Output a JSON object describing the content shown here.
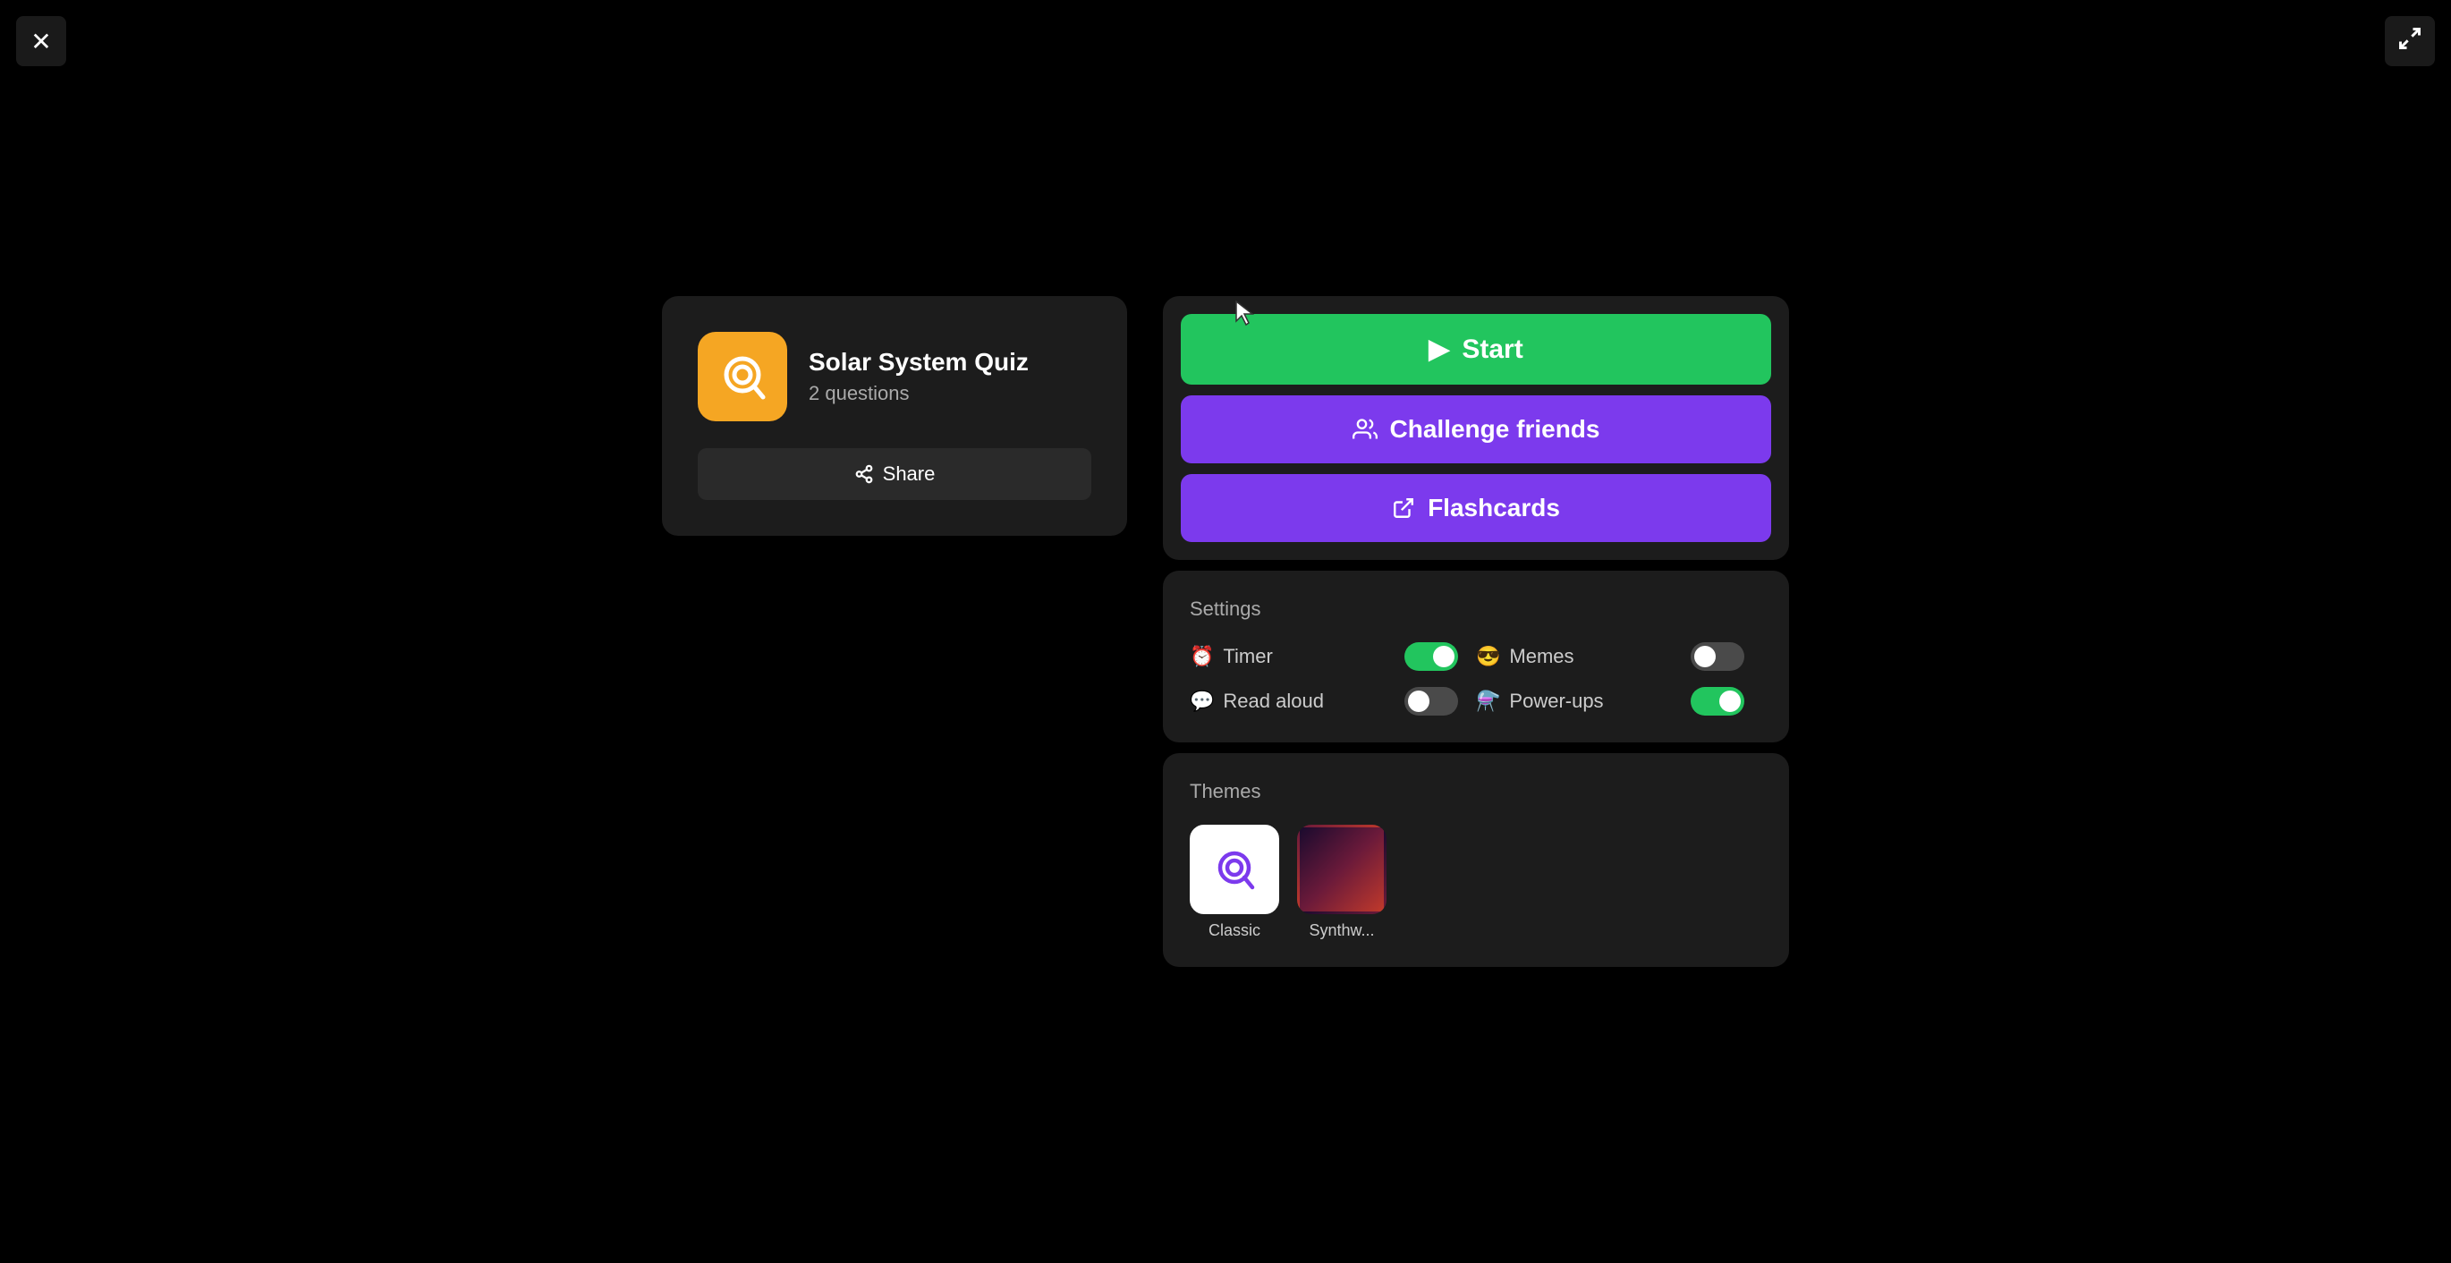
{
  "app": {
    "close_label": "✕",
    "fullscreen_label": "⛶"
  },
  "left_card": {
    "quiz_title": "Solar System Quiz",
    "quiz_subtitle": "2 questions",
    "share_label": "Share"
  },
  "action_buttons": {
    "start_label": "Start",
    "challenge_label": "Challenge friends",
    "flashcards_label": "Flashcards"
  },
  "settings": {
    "title": "Settings",
    "items": [
      {
        "id": "timer",
        "label": "Timer",
        "icon": "⏰",
        "state": "on"
      },
      {
        "id": "memes",
        "label": "Memes",
        "icon": "😎",
        "state": "off"
      },
      {
        "id": "read_aloud",
        "label": "Read aloud",
        "icon": "💬",
        "state": "off"
      },
      {
        "id": "powerups",
        "label": "Power-ups",
        "icon": "⚗️",
        "state": "on"
      }
    ]
  },
  "themes": {
    "title": "Themes",
    "items": [
      {
        "id": "classic",
        "label": "Classic",
        "selected": true
      },
      {
        "id": "synthwave",
        "label": "Synthw...",
        "selected": false
      }
    ]
  }
}
